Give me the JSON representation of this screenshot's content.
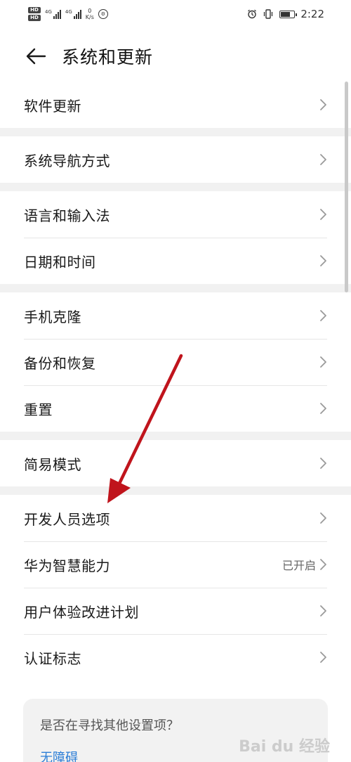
{
  "status_bar": {
    "hd1": "HD",
    "hd2": "HD",
    "net1": "4G",
    "net2": "4G",
    "speed_value": "0",
    "speed_unit": "K/s",
    "time": "2:22",
    "battery_level": 0.7
  },
  "header": {
    "title": "系统和更新"
  },
  "sections": [
    {
      "items": [
        {
          "label": "软件更新",
          "status": ""
        }
      ]
    },
    {
      "items": [
        {
          "label": "系统导航方式",
          "status": ""
        }
      ]
    },
    {
      "items": [
        {
          "label": "语言和输入法",
          "status": ""
        },
        {
          "label": "日期和时间",
          "status": ""
        }
      ]
    },
    {
      "items": [
        {
          "label": "手机克隆",
          "status": ""
        },
        {
          "label": "备份和恢复",
          "status": ""
        },
        {
          "label": "重置",
          "status": ""
        }
      ]
    },
    {
      "items": [
        {
          "label": "简易模式",
          "status": ""
        }
      ]
    },
    {
      "items": [
        {
          "label": "开发人员选项",
          "status": ""
        },
        {
          "label": "华为智慧能力",
          "status": "已开启"
        },
        {
          "label": "用户体验改进计划",
          "status": ""
        },
        {
          "label": "认证标志",
          "status": ""
        }
      ]
    }
  ],
  "card": {
    "title": "是否在寻找其他设置项？",
    "link": "无障碍"
  },
  "annotation": {
    "arrow_color": "#c0141c"
  },
  "watermark": {
    "text": "Bai du 经验"
  },
  "colors": {
    "accent": "#2b7dd6",
    "section_gap": "#f1f1f1",
    "chevron": "#9a9a9a"
  }
}
